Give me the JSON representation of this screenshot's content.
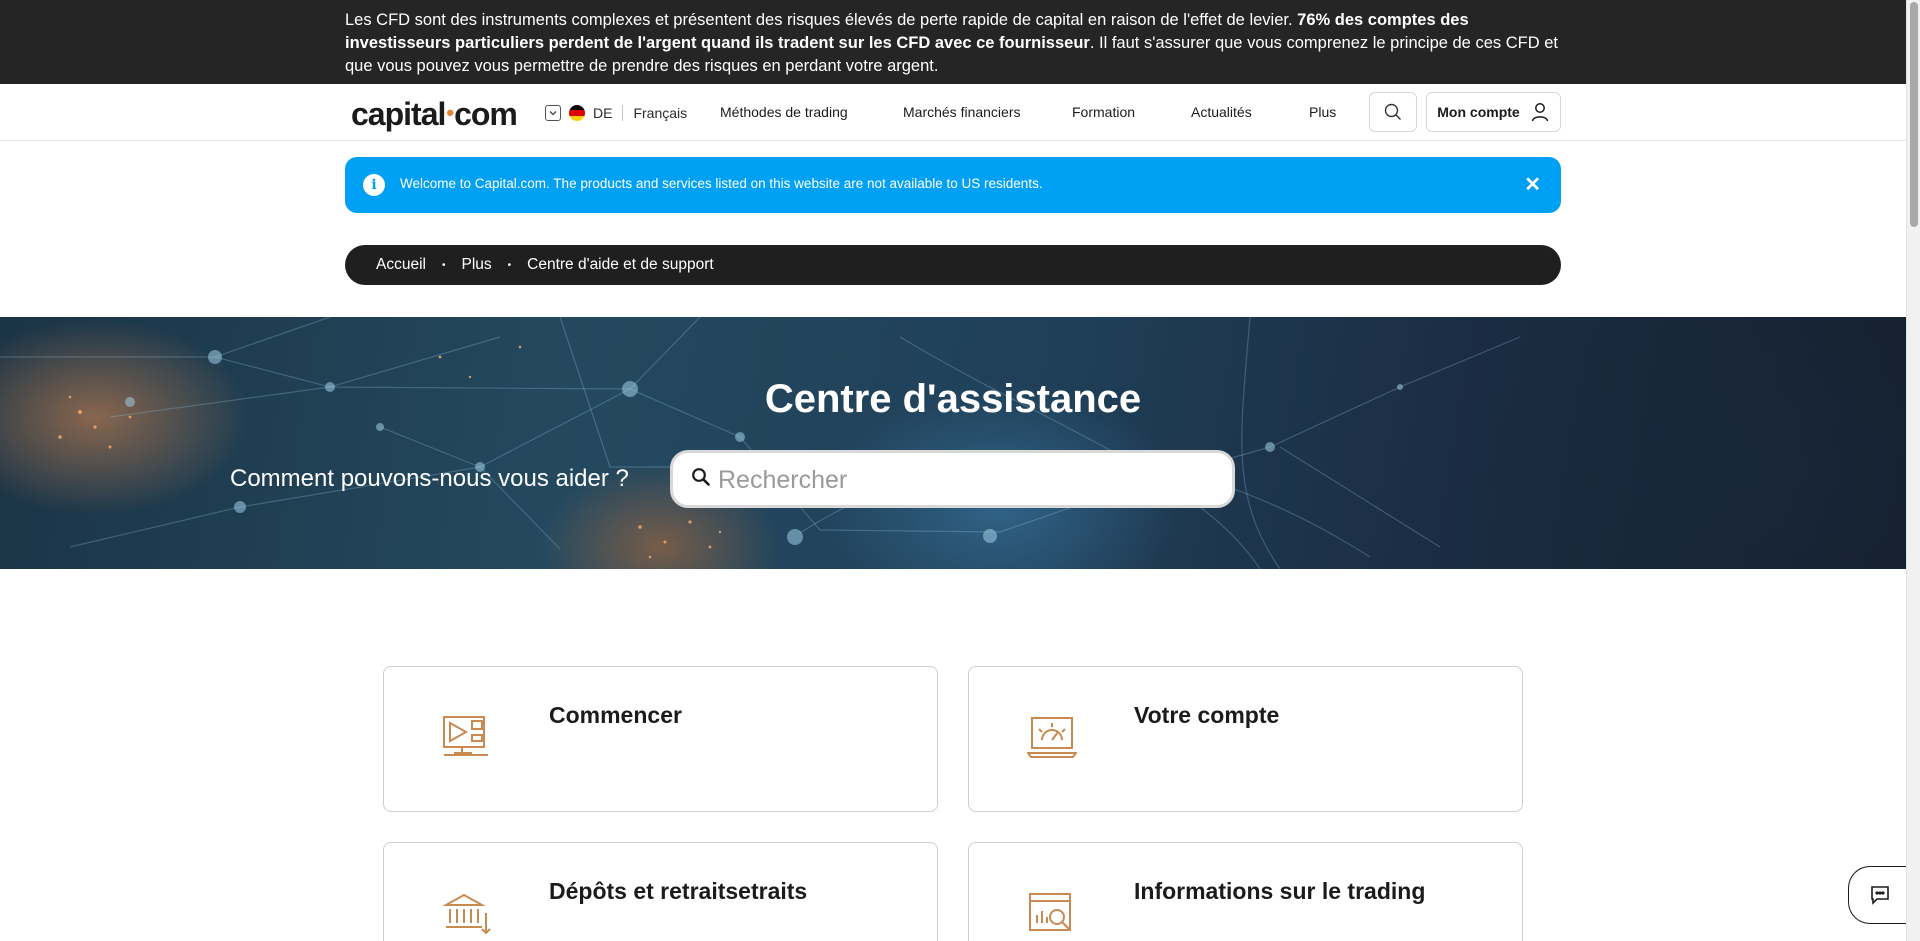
{
  "risk_banner": {
    "text_before": "Les CFD sont des instruments complexes et présentent des risques élevés de perte rapide de capital en raison de l'effet de levier. ",
    "text_bold": "76% des comptes des investisseurs particuliers perdent de l'argent quand ils tradent sur les CFD avec ce fournisseur",
    "text_after": ". Il faut s'assurer que vous comprenez le principe de ces CFD et que vous pouvez vous permettre de prendre des risques en perdant votre argent."
  },
  "header": {
    "logo_left": "capital",
    "logo_dot": "•",
    "logo_right": "com",
    "country_code": "DE",
    "language": "Français",
    "nav": [
      "Méthodes de trading",
      "Marchés financiers",
      "Formation",
      "Actualités",
      "Plus"
    ],
    "account_label": "Mon compte"
  },
  "welcome": {
    "message": "Welcome to Capital.com. The products and services listed on this website are not available to US residents.",
    "info_glyph": "i",
    "close_glyph": "✕"
  },
  "breadcrumb": {
    "items": [
      "Accueil",
      "Plus",
      "Centre d'aide et de support"
    ],
    "separator": "•"
  },
  "hero": {
    "title": "Centre d'assistance",
    "prompt": "Comment pouvons-nous vous aider ?",
    "search_placeholder": "Rechercher"
  },
  "cards": [
    {
      "title": "Commencer",
      "icon": "video-screen-icon"
    },
    {
      "title": "Votre compte",
      "icon": "laptop-gauge-icon"
    },
    {
      "title": "Dépôts et retraitsetraits",
      "icon": "bank-transfer-icon"
    },
    {
      "title": "Informations sur le trading",
      "icon": "chart-magnifier-icon"
    }
  ],
  "colors": {
    "accent_blue": "#00a0f5",
    "dark": "#1f1f1f",
    "icon_orange": "#c98a52",
    "logo_dot": "#e2862f"
  }
}
